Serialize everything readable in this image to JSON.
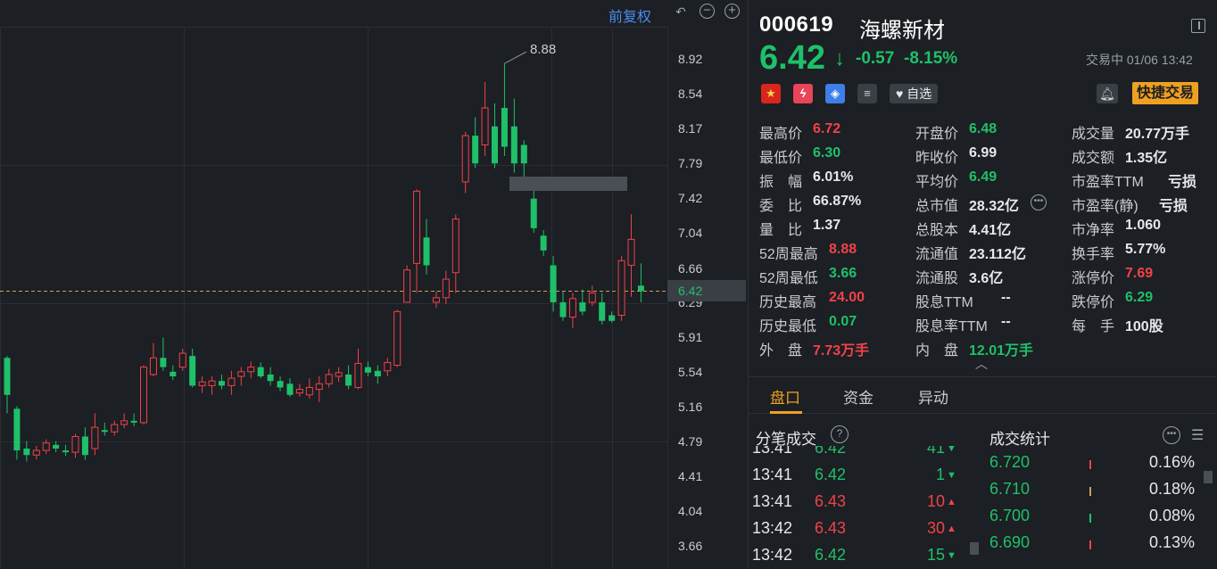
{
  "toolbar": {
    "adjust_label": "前复权",
    "icons": [
      "undo-icon",
      "zoom-out-icon",
      "zoom-in-icon"
    ]
  },
  "chart_data": {
    "type": "candlestick",
    "y_ticks": [
      "8.92",
      "8.54",
      "8.17",
      "7.79",
      "7.42",
      "7.04",
      "6.66",
      "6.29",
      "5.91",
      "5.54",
      "5.16",
      "4.79",
      "4.41",
      "4.04",
      "3.66"
    ],
    "ylim": [
      3.66,
      8.92
    ],
    "current_price": "6.42",
    "peak_label": "8.88",
    "up_color": "#f0424a",
    "down_color": "#1fc06a",
    "candles": [
      {
        "o": 5.7,
        "c": 5.3,
        "h": 5.72,
        "l": 5.1
      },
      {
        "o": 5.15,
        "c": 4.7,
        "h": 5.18,
        "l": 4.6
      },
      {
        "o": 4.72,
        "c": 4.65,
        "h": 4.8,
        "l": 4.58
      },
      {
        "o": 4.65,
        "c": 4.7,
        "h": 4.75,
        "l": 4.6
      },
      {
        "o": 4.7,
        "c": 4.78,
        "h": 4.82,
        "l": 4.66
      },
      {
        "o": 4.76,
        "c": 4.72,
        "h": 4.8,
        "l": 4.68
      },
      {
        "o": 4.7,
        "c": 4.68,
        "h": 4.76,
        "l": 4.64
      },
      {
        "o": 4.68,
        "c": 4.85,
        "h": 4.88,
        "l": 4.62
      },
      {
        "o": 4.85,
        "c": 4.65,
        "h": 4.95,
        "l": 4.6
      },
      {
        "o": 4.72,
        "c": 4.95,
        "h": 5.1,
        "l": 4.65
      },
      {
        "o": 4.92,
        "c": 4.9,
        "h": 5.0,
        "l": 4.86
      },
      {
        "o": 4.9,
        "c": 4.98,
        "h": 5.02,
        "l": 4.86
      },
      {
        "o": 4.98,
        "c": 5.02,
        "h": 5.1,
        "l": 4.94
      },
      {
        "o": 5.02,
        "c": 5.0,
        "h": 5.1,
        "l": 4.96
      },
      {
        "o": 5.0,
        "c": 5.6,
        "h": 5.62,
        "l": 4.98
      },
      {
        "o": 5.52,
        "c": 5.7,
        "h": 5.86,
        "l": 5.5
      },
      {
        "o": 5.7,
        "c": 5.6,
        "h": 5.92,
        "l": 5.56
      },
      {
        "o": 5.55,
        "c": 5.5,
        "h": 5.62,
        "l": 5.46
      },
      {
        "o": 5.6,
        "c": 5.75,
        "h": 5.8,
        "l": 5.56
      },
      {
        "o": 5.72,
        "c": 5.4,
        "h": 5.8,
        "l": 5.38
      },
      {
        "o": 5.4,
        "c": 5.44,
        "h": 5.5,
        "l": 5.32
      },
      {
        "o": 5.4,
        "c": 5.45,
        "h": 5.5,
        "l": 5.3
      },
      {
        "o": 5.45,
        "c": 5.4,
        "h": 5.52,
        "l": 5.36
      },
      {
        "o": 5.4,
        "c": 5.48,
        "h": 5.56,
        "l": 5.3
      },
      {
        "o": 5.5,
        "c": 5.55,
        "h": 5.6,
        "l": 5.4
      },
      {
        "o": 5.55,
        "c": 5.6,
        "h": 5.66,
        "l": 5.48
      },
      {
        "o": 5.6,
        "c": 5.5,
        "h": 5.65,
        "l": 5.48
      },
      {
        "o": 5.52,
        "c": 5.45,
        "h": 5.6,
        "l": 5.4
      },
      {
        "o": 5.45,
        "c": 5.38,
        "h": 5.5,
        "l": 5.34
      },
      {
        "o": 5.42,
        "c": 5.3,
        "h": 5.48,
        "l": 5.28
      },
      {
        "o": 5.32,
        "c": 5.36,
        "h": 5.42,
        "l": 5.28
      },
      {
        "o": 5.3,
        "c": 5.38,
        "h": 5.48,
        "l": 5.26
      },
      {
        "o": 5.36,
        "c": 5.42,
        "h": 5.5,
        "l": 5.22
      },
      {
        "o": 5.42,
        "c": 5.52,
        "h": 5.58,
        "l": 5.38
      },
      {
        "o": 5.5,
        "c": 5.54,
        "h": 5.6,
        "l": 5.44
      },
      {
        "o": 5.52,
        "c": 5.4,
        "h": 5.62,
        "l": 5.36
      },
      {
        "o": 5.38,
        "c": 5.64,
        "h": 5.8,
        "l": 5.36
      },
      {
        "o": 5.6,
        "c": 5.54,
        "h": 5.66,
        "l": 5.5
      },
      {
        "o": 5.56,
        "c": 5.5,
        "h": 5.62,
        "l": 5.42
      },
      {
        "o": 5.56,
        "c": 5.65,
        "h": 5.7,
        "l": 5.5
      },
      {
        "o": 5.62,
        "c": 6.2,
        "h": 6.22,
        "l": 5.6
      },
      {
        "o": 6.3,
        "c": 6.65,
        "h": 6.7,
        "l": 6.3
      },
      {
        "o": 6.72,
        "c": 7.5,
        "h": 7.52,
        "l": 6.4
      },
      {
        "o": 7.0,
        "c": 6.7,
        "h": 7.2,
        "l": 6.6
      },
      {
        "o": 6.3,
        "c": 6.35,
        "h": 6.42,
        "l": 6.24
      },
      {
        "o": 6.35,
        "c": 6.55,
        "h": 6.64,
        "l": 6.28
      },
      {
        "o": 6.62,
        "c": 7.2,
        "h": 7.25,
        "l": 6.4
      },
      {
        "o": 7.6,
        "c": 8.1,
        "h": 8.14,
        "l": 7.48
      },
      {
        "o": 8.1,
        "c": 7.8,
        "h": 8.3,
        "l": 7.75
      },
      {
        "o": 8.0,
        "c": 8.4,
        "h": 8.68,
        "l": 7.88
      },
      {
        "o": 8.2,
        "c": 7.8,
        "h": 8.45,
        "l": 7.75
      },
      {
        "o": 8.4,
        "c": 7.98,
        "h": 8.88,
        "l": 7.88
      },
      {
        "o": 8.2,
        "c": 7.8,
        "h": 8.5,
        "l": 7.7
      },
      {
        "o": 8.0,
        "c": 7.8,
        "h": 8.05,
        "l": 7.6
      },
      {
        "o": 7.42,
        "c": 7.1,
        "h": 7.52,
        "l": 7.05
      },
      {
        "o": 7.02,
        "c": 6.86,
        "h": 7.08,
        "l": 6.8
      },
      {
        "o": 6.7,
        "c": 6.3,
        "h": 6.8,
        "l": 6.2
      },
      {
        "o": 6.3,
        "c": 6.14,
        "h": 6.42,
        "l": 6.1
      },
      {
        "o": 6.14,
        "c": 6.34,
        "h": 6.4,
        "l": 6.02
      },
      {
        "o": 6.3,
        "c": 6.2,
        "h": 6.44,
        "l": 6.16
      },
      {
        "o": 6.3,
        "c": 6.4,
        "h": 6.48,
        "l": 6.26
      },
      {
        "o": 6.3,
        "c": 6.1,
        "h": 6.4,
        "l": 6.06
      },
      {
        "o": 6.16,
        "c": 6.1,
        "h": 6.2,
        "l": 6.08
      },
      {
        "o": 6.16,
        "c": 6.75,
        "h": 6.8,
        "l": 6.1
      },
      {
        "o": 6.7,
        "c": 6.98,
        "h": 7.25,
        "l": 6.36
      },
      {
        "o": 6.48,
        "c": 6.42,
        "h": 6.72,
        "l": 6.3
      }
    ]
  },
  "quote": {
    "code": "000619",
    "name": "海螺新材",
    "price": "6.42",
    "change": "-0.57",
    "change_pct": "-8.15%",
    "status_time": "交易中 01/06 13:42",
    "watch_label": "自选",
    "trade_label": "快捷交易",
    "col1": [
      {
        "label": "最高价",
        "value": "6.72",
        "color": "red"
      },
      {
        "label": "最低价",
        "value": "6.30",
        "color": "green"
      },
      {
        "label": "振　幅",
        "value": "6.01%",
        "color": "white"
      },
      {
        "label": "委　比",
        "value": "66.87%",
        "color": "white"
      },
      {
        "label": "量　比",
        "value": "1.37",
        "color": "white"
      },
      {
        "label": "52周最高",
        "value": "8.88",
        "color": "red"
      },
      {
        "label": "52周最低",
        "value": "3.66",
        "color": "green"
      },
      {
        "label": "历史最高",
        "value": "24.00",
        "color": "red"
      },
      {
        "label": "历史最低",
        "value": "0.07",
        "color": "green"
      },
      {
        "label": "外　盘",
        "value": "7.73万手",
        "color": "red"
      }
    ],
    "col2": [
      {
        "label": "开盘价",
        "value": "6.48",
        "color": "green"
      },
      {
        "label": "昨收价",
        "value": "6.99",
        "color": "white"
      },
      {
        "label": "平均价",
        "value": "6.49",
        "color": "green"
      },
      {
        "label": "总市值",
        "value": "28.32亿",
        "color": "white"
      },
      {
        "label": "总股本",
        "value": "4.41亿",
        "color": "white"
      },
      {
        "label": "流通值",
        "value": "23.112亿",
        "color": "white"
      },
      {
        "label": "流通股",
        "value": "3.6亿",
        "color": "white"
      },
      {
        "label": "股息TTM",
        "value": "--",
        "color": "white"
      },
      {
        "label": "股息率TTM",
        "value": "--",
        "color": "white"
      },
      {
        "label": "内　盘",
        "value": "12.01万手",
        "color": "green"
      }
    ],
    "col3": [
      {
        "label": "成交量",
        "value": "20.77万手",
        "color": "white"
      },
      {
        "label": "成交额",
        "value": "1.35亿",
        "color": "white"
      },
      {
        "label": "市盈率TTM",
        "value": "亏损",
        "color": "white"
      },
      {
        "label": "市盈率(静)",
        "value": "亏损",
        "color": "white"
      },
      {
        "label": "市净率",
        "value": "1.060",
        "color": "white"
      },
      {
        "label": "换手率",
        "value": "5.77%",
        "color": "white"
      },
      {
        "label": "涨停价",
        "value": "7.69",
        "color": "red"
      },
      {
        "label": "跌停价",
        "value": "6.29",
        "color": "green"
      },
      {
        "label": "每　手",
        "value": "100股",
        "color": "white"
      }
    ]
  },
  "tabs": [
    "盘口",
    "资金",
    "异动"
  ],
  "ticks": {
    "title": "分笔成交",
    "rows": [
      {
        "time": "13:41",
        "price": "6.42",
        "vol": "41",
        "dir": "down"
      },
      {
        "time": "13:41",
        "price": "6.42",
        "vol": "1",
        "dir": "down"
      },
      {
        "time": "13:41",
        "price": "6.43",
        "vol": "10",
        "dir": "up"
      },
      {
        "time": "13:42",
        "price": "6.43",
        "vol": "30",
        "dir": "up"
      },
      {
        "time": "13:42",
        "price": "6.42",
        "vol": "15",
        "dir": "down"
      }
    ]
  },
  "stats": {
    "title": "成交统计",
    "rows": [
      {
        "price": "6.720",
        "pct": "0.16%",
        "bar": "red"
      },
      {
        "price": "6.710",
        "pct": "0.18%",
        "bar": "gold"
      },
      {
        "price": "6.700",
        "pct": "0.08%",
        "bar": "green"
      },
      {
        "price": "6.690",
        "pct": "0.13%",
        "bar": "red"
      }
    ]
  }
}
